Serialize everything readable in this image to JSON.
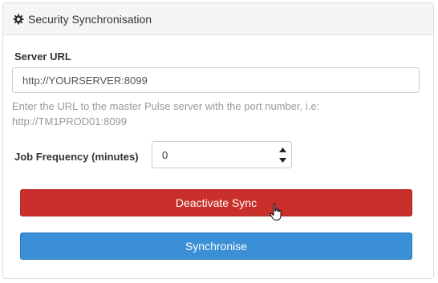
{
  "panel": {
    "title": "Security Synchronisation",
    "icon": "gear-icon"
  },
  "server_url": {
    "label": "Server URL",
    "value": "http://YOURSERVER:8099",
    "help_line1": "Enter the URL to the master Pulse server with the port number, i.e:",
    "help_line2": "http://TM1PROD01:8099"
  },
  "job_frequency": {
    "label": "Job Frequency (minutes)",
    "value": "0",
    "up_icon": "triangle-up-icon",
    "down_icon": "triangle-down-icon"
  },
  "buttons": {
    "deactivate_label": "Deactivate Sync",
    "deactivate_color": "#c9302c",
    "synchronise_label": "Synchronise",
    "synchronise_color": "#3a8fd6"
  },
  "cursor": {
    "icon": "hand-pointer-icon"
  }
}
